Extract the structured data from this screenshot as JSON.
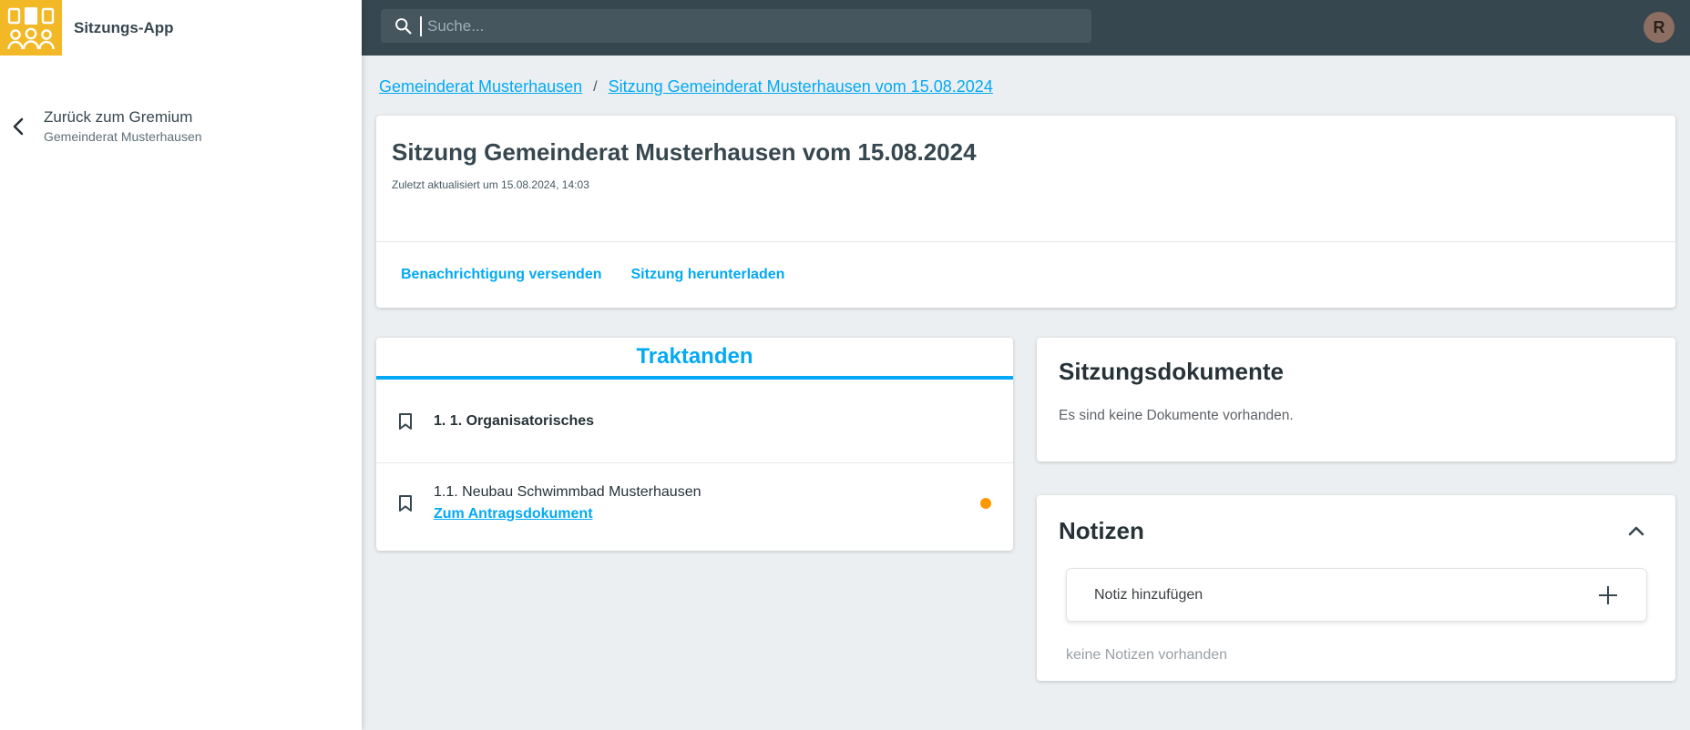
{
  "app": {
    "title": "Sitzungs-App"
  },
  "topbar": {
    "search_placeholder": "Suche...",
    "avatar_initial": "R"
  },
  "sidebar": {
    "back_label": "Zurück zum Gremium",
    "back_sublabel": "Gemeinderat Musterhausen"
  },
  "breadcrumb": {
    "separator": "/",
    "items": [
      {
        "label": "Gemeinderat Musterhausen"
      },
      {
        "label": "Sitzung Gemeinderat Musterhausen vom 15.08.2024"
      }
    ]
  },
  "session": {
    "title": "Sitzung Gemeinderat Musterhausen vom 15.08.2024",
    "updated": "Zuletzt aktualisiert um 15.08.2024, 14:03",
    "actions": [
      {
        "label": "Benachrichtigung versenden"
      },
      {
        "label": "Sitzung herunterladen"
      }
    ]
  },
  "agenda": {
    "title": "Traktanden",
    "items": [
      {
        "title": "1. 1. Organisatorisches"
      },
      {
        "title": "1.1. Neubau Schwimmbad Musterhausen",
        "link_label": "Zum Antragsdokument",
        "has_indicator": true
      }
    ]
  },
  "documents": {
    "title": "Sitzungsdokumente",
    "empty_message": "Es sind keine Dokumente vorhanden."
  },
  "notes": {
    "title": "Notizen",
    "add_label": "Notiz hinzufügen",
    "empty_message": "keine Notizen vorhanden"
  },
  "colors": {
    "accent_blue": "#03A9F4",
    "topbar_bg": "#37474F",
    "logo_yellow": "#F2B826",
    "indicator_orange": "#FF9800",
    "avatar_bg": "#8D6E63",
    "page_bg": "#ECEFF1"
  }
}
